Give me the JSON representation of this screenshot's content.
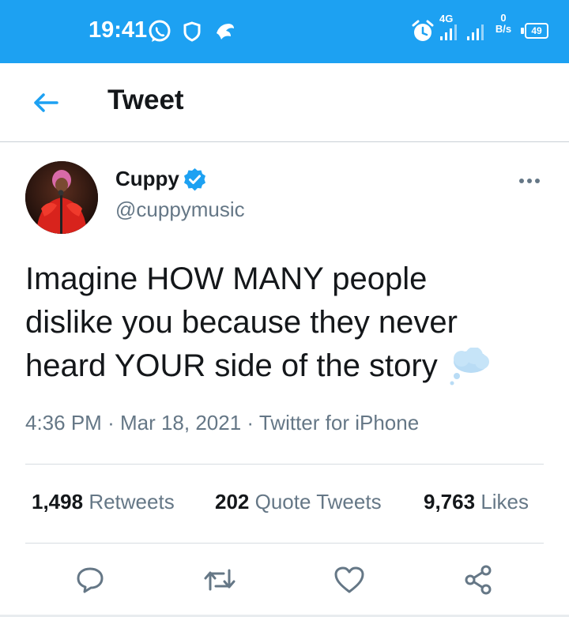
{
  "status_bar": {
    "time": "19:41",
    "network": "4G",
    "speed_value": "0",
    "speed_unit": "B/s",
    "battery": "49"
  },
  "header": {
    "title": "Tweet"
  },
  "tweet": {
    "author_name": "Cuppy",
    "handle": "@cuppymusic",
    "text_lines": [
      "Imagine HOW MANY people",
      "dislike you because they never",
      "heard YOUR side of the story"
    ],
    "time": "4:36 PM",
    "date": "Mar 18, 2021",
    "source": "Twitter for iPhone",
    "separator": "·"
  },
  "stats": {
    "retweets_count": "1,498",
    "retweets_label": "Retweets",
    "quotes_count": "202",
    "quotes_label": "Quote Tweets",
    "likes_count": "9,763",
    "likes_label": "Likes"
  },
  "icons": {
    "back": "arrow-left-icon",
    "verified": "verified-badge-icon",
    "more": "more-dots-icon",
    "reply": "reply-icon",
    "retweet": "retweet-icon",
    "like": "heart-icon",
    "share": "share-icon",
    "emoji": "thought-balloon-emoji"
  },
  "colors": {
    "brand": "#1da1f2",
    "text": "#14171a",
    "secondary": "#657786",
    "divider": "#d7dde2"
  }
}
